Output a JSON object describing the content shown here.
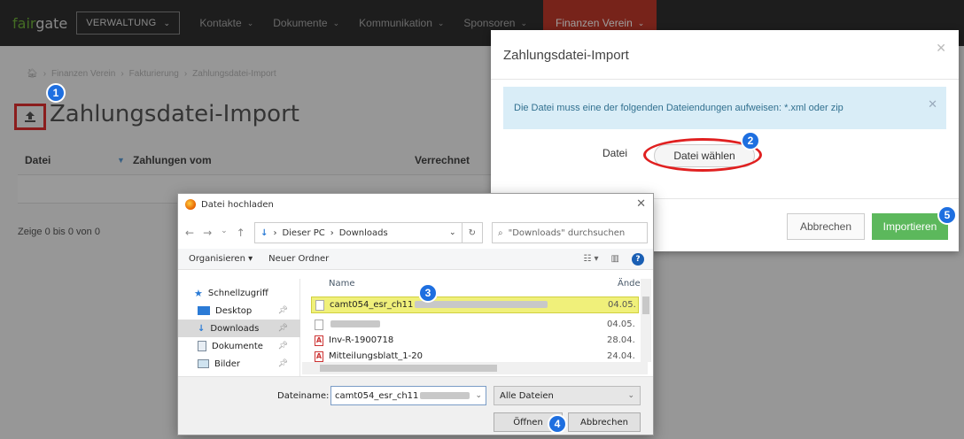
{
  "nav": {
    "logo_a": "fair",
    "logo_b": "gate",
    "verwaltung": "VERWALTUNG",
    "items": [
      "Kontakte",
      "Dokumente",
      "Kommunikation",
      "Sponsoren"
    ],
    "active": "Finanzen Verein"
  },
  "page": {
    "breadcrumb": [
      "Finanzen Verein",
      "Fakturierung",
      "Zahlungsdatei-Import"
    ],
    "title": "Zahlungsdatei-Import",
    "columns": [
      "Datei",
      "Zahlungen vom",
      "Verrechnet"
    ],
    "summary": "Zeige 0 bis 0 von 0"
  },
  "modal": {
    "title": "Zahlungsdatei-Import",
    "alert": "Die Datei muss eine der folgenden Dateiendungen aufweisen: *.xml oder zip",
    "file_label": "Datei",
    "file_button": "Datei wählen",
    "cancel": "Abbrechen",
    "import": "Importieren"
  },
  "dialog": {
    "title": "Datei hochladen",
    "path": [
      "Dieser PC",
      "Downloads"
    ],
    "search_placeholder": "\"Downloads\" durchsuchen",
    "organize": "Organisieren",
    "new_folder": "Neuer Ordner",
    "nav_items": [
      {
        "label": "Schnellzugriff",
        "icon": "star-icon"
      },
      {
        "label": "Desktop",
        "icon": "desktop-icon"
      },
      {
        "label": "Downloads",
        "icon": "download-icon"
      },
      {
        "label": "Dokumente",
        "icon": "document-icon"
      },
      {
        "label": "Bilder",
        "icon": "picture-icon"
      }
    ],
    "col_name": "Name",
    "col_date": "Ände",
    "files": [
      {
        "name": "camt054_esr_ch11",
        "date": "04.05.",
        "type": "file"
      },
      {
        "name": "",
        "date": "04.05.",
        "type": "file"
      },
      {
        "name": "Inv-R-1900718",
        "date": "28.04.",
        "type": "pdf"
      },
      {
        "name": "Mitteilungsblatt_1-20",
        "date": "24.04.",
        "type": "pdf"
      }
    ],
    "filename_label": "Dateiname:",
    "filename_value": "camt054_esr_ch11",
    "filetype": "Alle Dateien",
    "open": "Öffnen",
    "cancel": "Abbrechen"
  },
  "badges": [
    "1",
    "2",
    "3",
    "4",
    "5"
  ]
}
